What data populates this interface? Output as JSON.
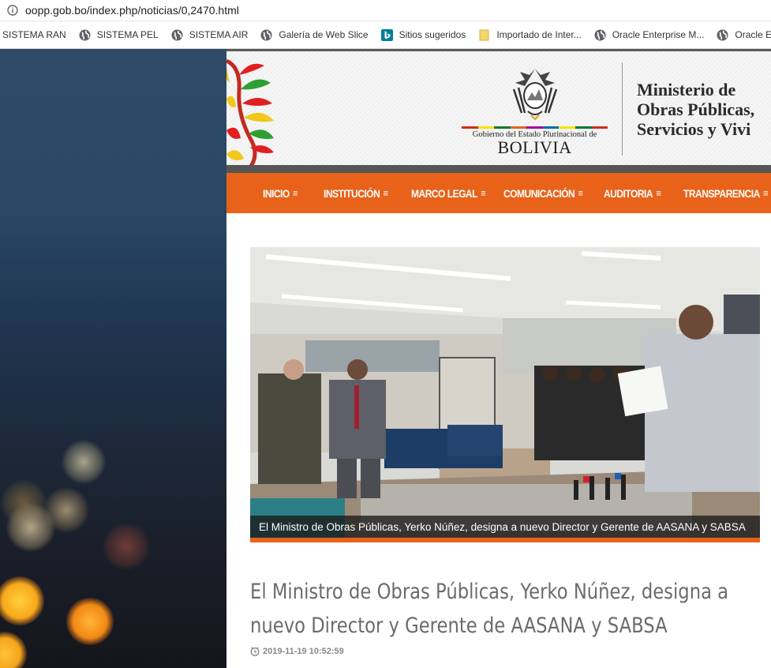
{
  "browser": {
    "url": "oopp.gob.bo/index.php/noticias/0,2470.html",
    "bookmarks": [
      {
        "label": "SISTEMA RAN",
        "icon": "none"
      },
      {
        "label": "SISTEMA PEL",
        "icon": "globe-icon"
      },
      {
        "label": "SISTEMA AIR",
        "icon": "globe-icon"
      },
      {
        "label": "Galería de Web Slice",
        "icon": "globe-icon"
      },
      {
        "label": "Sitios sugeridos",
        "icon": "bing-icon"
      },
      {
        "label": "Importado de Inter...",
        "icon": "folder-icon"
      },
      {
        "label": "Oracle Enterprise M...",
        "icon": "globe-icon"
      },
      {
        "label": "Oracle Enter",
        "icon": "globe-icon"
      }
    ]
  },
  "site": {
    "gov_text": "Gobierno del Estado Plurinacional de",
    "country": "BOLIVIA",
    "ministry_lines": [
      "Ministerio de",
      "Obras Públicas,",
      "Servicios y Vivi"
    ],
    "nav": [
      "INICIO",
      "INSTITUCIÓN",
      "MARCO LEGAL",
      "COMUNICACIÓN",
      "AUDITORIA",
      "TRANSPARENCIA"
    ],
    "nav_icon": "≡",
    "accent_color": "#e8621a",
    "photo_caption": "El Ministro de Obras Públicas, Yerko Núñez, designa a nuevo Director y Gerente de AASANA y SABSA",
    "headline": "El Ministro de Obras Públicas, Yerko Núñez, designa a nuevo Director y Gerente de AASANA y SABSA",
    "date": "2019-11-19 10:52:59"
  }
}
